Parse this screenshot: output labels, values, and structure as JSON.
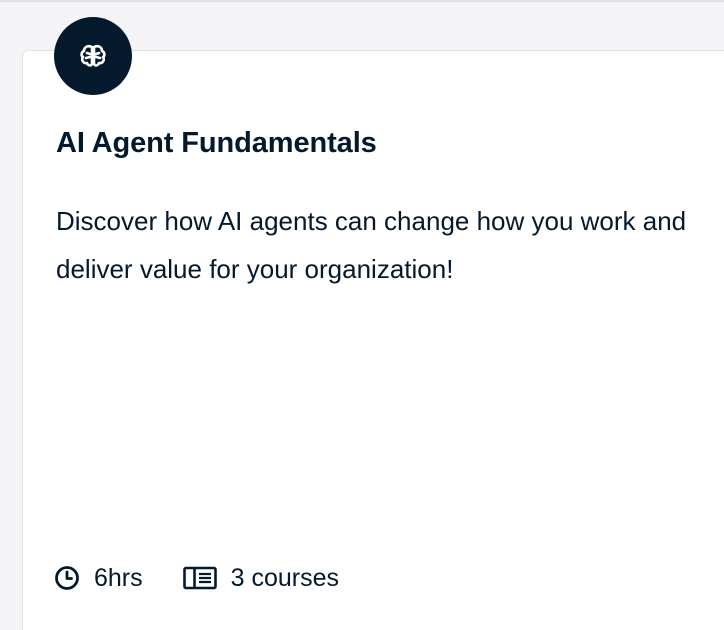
{
  "card": {
    "badge_icon": "brain-icon",
    "title": "AI Agent Fundamentals",
    "description": "Discover how AI agents can change how you work and deliver value for your organization!",
    "meta": {
      "duration_icon": "clock-icon",
      "duration": "6hrs",
      "courses_icon": "book-icon",
      "courses": "3 courses"
    }
  },
  "colors": {
    "ink": "#05192d",
    "card_bg": "#ffffff",
    "page_bg": "#f4f4f6",
    "border": "#dfe2e6"
  }
}
